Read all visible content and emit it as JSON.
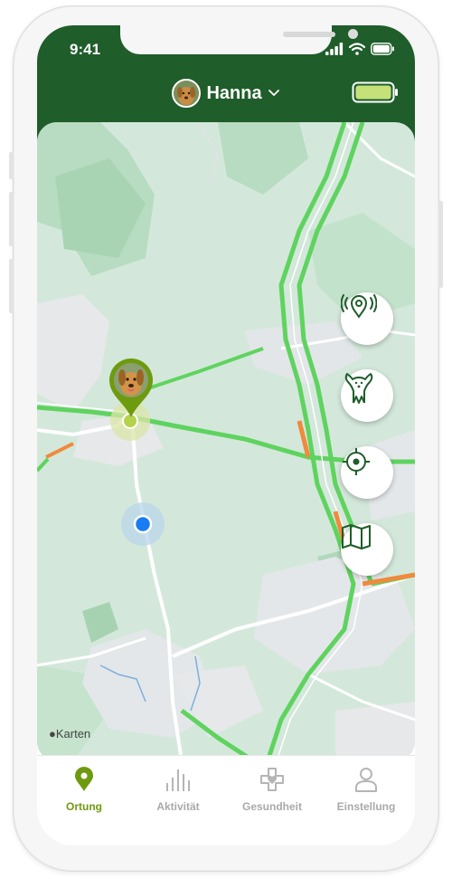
{
  "status_bar": {
    "time": "9:41"
  },
  "header": {
    "pet_name": "Hanna"
  },
  "map": {
    "attribution": "Karten"
  },
  "map_buttons": [
    {
      "icon": "location-signal-icon"
    },
    {
      "icon": "dog-icon"
    },
    {
      "icon": "crosshair-icon"
    },
    {
      "icon": "map-icon"
    }
  ],
  "tabs": [
    {
      "label": "Ortung",
      "icon": "location-pin-icon",
      "active": true
    },
    {
      "label": "Aktivität",
      "icon": "activity-bars-icon",
      "active": false
    },
    {
      "label": "Gesundheit",
      "icon": "health-cross-icon",
      "active": false
    },
    {
      "label": "Einstellung",
      "icon": "person-icon",
      "active": false
    }
  ],
  "colors": {
    "brand_green": "#1f5d2a",
    "accent_green": "#6e9a10",
    "road_green": "#5fd35f",
    "road_orange": "#f08a3c",
    "user_dot": "#1a7cf2",
    "battery_fill": "#c5e27a"
  }
}
